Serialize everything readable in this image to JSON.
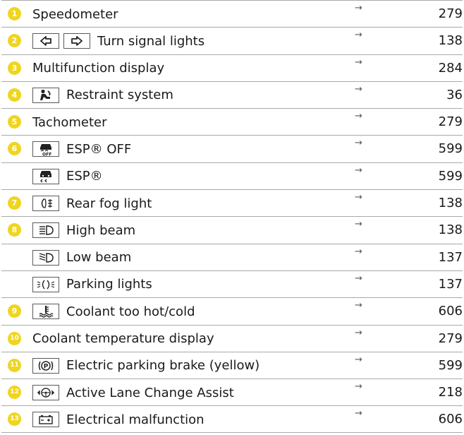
{
  "arrow": "→",
  "rows": [
    {
      "num": "1",
      "label": "Speedometer",
      "page": "279"
    },
    {
      "num": "2",
      "label": "Turn signal lights",
      "page": "138"
    },
    {
      "num": "3",
      "label": "Multifunction display",
      "page": "284"
    },
    {
      "num": "4",
      "label": "Restraint system",
      "page": "36"
    },
    {
      "num": "5",
      "label": "Tachometer",
      "page": "279"
    },
    {
      "num": "6",
      "label": "ESP® OFF",
      "page": "599"
    },
    {
      "num": "",
      "label": "ESP®",
      "page": "599"
    },
    {
      "num": "7",
      "label": "Rear fog light",
      "page": "138"
    },
    {
      "num": "8",
      "label": "High beam",
      "page": "138"
    },
    {
      "num": "",
      "label": "Low beam",
      "page": "137"
    },
    {
      "num": "",
      "label": "Parking lights",
      "page": "137"
    },
    {
      "num": "9",
      "label": "Coolant too hot/cold",
      "page": "606"
    },
    {
      "num": "10",
      "label": "Coolant temperature display",
      "page": "279"
    },
    {
      "num": "11",
      "label": "Electric parking brake (yellow)",
      "page": "599"
    },
    {
      "num": "12",
      "label": "Active Lane Change Assist",
      "page": "218"
    },
    {
      "num": "13",
      "label": "Electrical malfunction",
      "page": "606"
    }
  ],
  "icons": {
    "turn_left": "turn-signal-left-icon",
    "turn_right": "turn-signal-right-icon",
    "restraint": "restraint-system-icon",
    "esp_off": "esp-off-icon",
    "esp": "esp-icon",
    "rear_fog": "rear-fog-light-icon",
    "high_beam": "high-beam-icon",
    "low_beam": "low-beam-icon",
    "parking_lights": "parking-lights-icon",
    "coolant": "coolant-temperature-icon",
    "parking_brake": "electric-parking-brake-icon",
    "lane_change": "active-lane-change-assist-icon",
    "battery": "electrical-malfunction-icon"
  },
  "colors": {
    "badge": "#f0d520",
    "rule": "#a9a9a9"
  }
}
